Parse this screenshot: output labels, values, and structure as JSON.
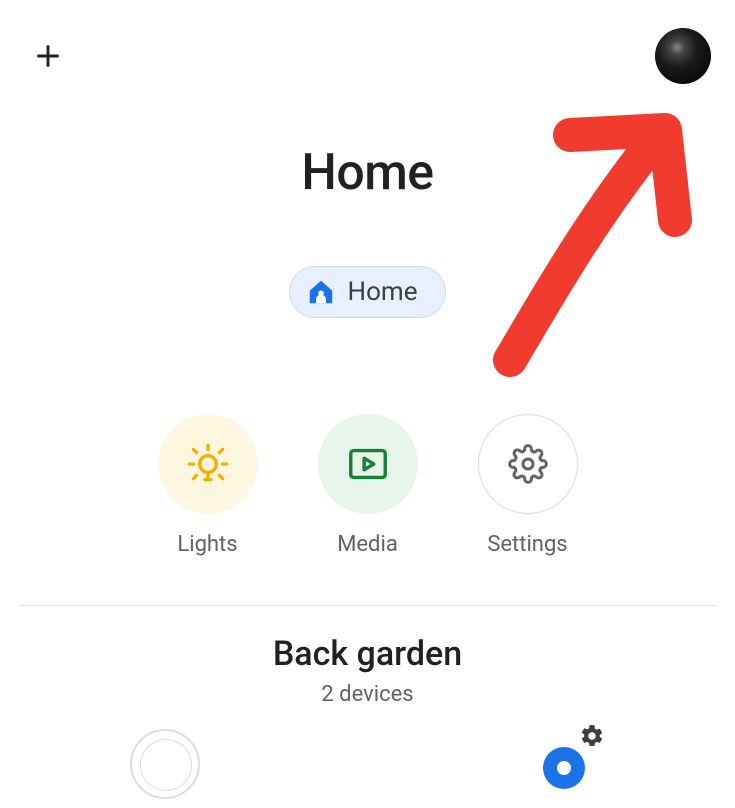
{
  "topbar": {
    "add_label": "Add",
    "avatar_label": "Account"
  },
  "title": "Home",
  "chip": {
    "label": "Home"
  },
  "actions": {
    "lights": "Lights",
    "media": "Media",
    "settings": "Settings"
  },
  "room": {
    "name": "Back garden",
    "device_count": "2 devices"
  },
  "colors": {
    "accent_blue": "#1a73e8",
    "lights_bg": "#fef7e0",
    "lights_icon": "#f9ab00",
    "media_bg": "#e6f4ea",
    "media_icon": "#188038",
    "annotation_red": "#f44336"
  }
}
